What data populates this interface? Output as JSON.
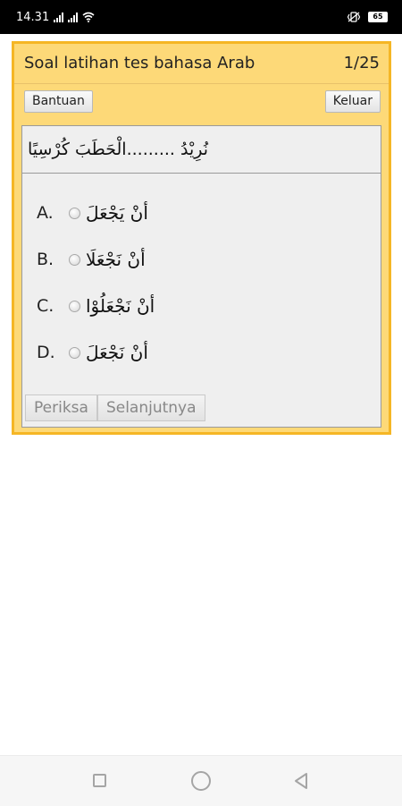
{
  "status_bar": {
    "time": "14.31",
    "battery": "65",
    "icons": [
      "signal-icon",
      "wifi-icon",
      "vibrate-icon",
      "battery-icon"
    ]
  },
  "quiz": {
    "title": "Soal latihan tes bahasa Arab",
    "counter": "1/25",
    "help_label": "Bantuan",
    "exit_label": "Keluar",
    "question": "نُرِيْدُ .........الْحَطَبَ كُرْسِيًا",
    "options": [
      {
        "letter": "A.",
        "text": "أنْ يَجْعَلَ"
      },
      {
        "letter": "B.",
        "text": "أنْ نَجْعَلَا"
      },
      {
        "letter": "C.",
        "text": "أنْ نَجْعَلُوْا"
      },
      {
        "letter": "D.",
        "text": "أنْ نَجْعَلَ"
      }
    ],
    "check_label": "Periksa",
    "next_label": "Selanjutnya"
  },
  "colors": {
    "panel_border": "#f5b625",
    "panel_bg": "#fdd978"
  },
  "nav_bar": {
    "icons": [
      "recents-square-icon",
      "home-circle-icon",
      "back-triangle-icon"
    ]
  }
}
